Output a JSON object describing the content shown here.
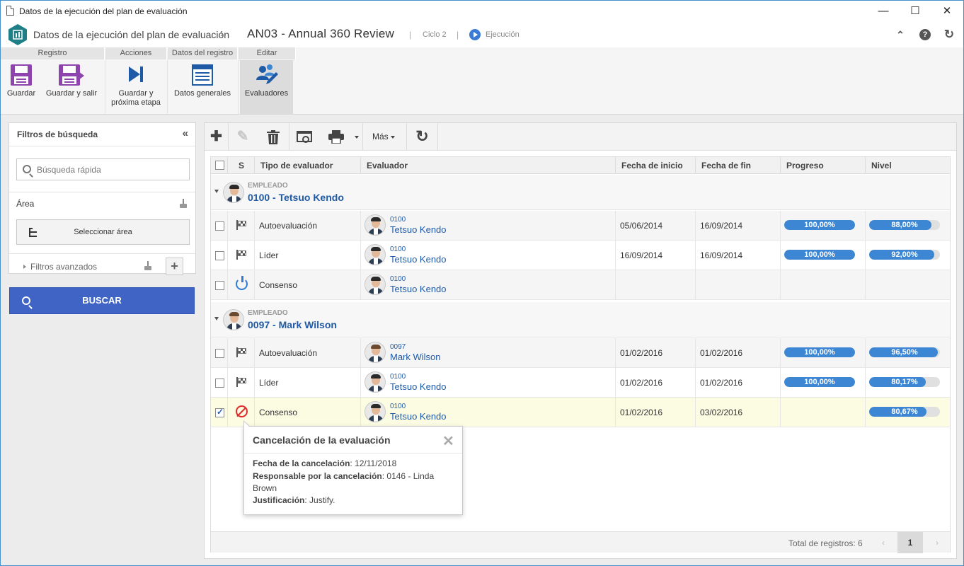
{
  "window": {
    "title": "Datos de la ejecución del plan de evaluación",
    "minimize": "—",
    "maximize": "☐",
    "close": "✕"
  },
  "header": {
    "breadcrumb": "Datos de la ejecución del plan de evaluación",
    "chevron": "›",
    "record": "AN03 - Annual 360 Review",
    "separator": "|",
    "cycle": "Ciclo 2",
    "status": "Ejecución",
    "icons": [
      "collapse-up-icon",
      "help-icon",
      "refresh-icon"
    ],
    "collapse_glyph": "⌃",
    "help_glyph": "?",
    "refresh_glyph": "↻"
  },
  "ribbon": {
    "groups": [
      "Registro",
      "Acciones",
      "Datos del registro",
      "Editar"
    ],
    "buttons": {
      "save": "Guardar",
      "save_exit": "Guardar y salir",
      "save_next_1": "Guardar y",
      "save_next_2": "próxima etapa",
      "general": "Datos generales",
      "evaluators": "Evaluadores"
    },
    "accent": "#8e44ad",
    "blue": "#1f5aa6"
  },
  "filters": {
    "title": "Filtros de búsqueda",
    "collapse": "«",
    "quick_search_placeholder": "Búsqueda rápida",
    "area_label": "Área",
    "select_area": "Seleccionar área",
    "advanced": "Filtros avanzados",
    "add": "+",
    "search_button": "BUSCAR"
  },
  "toolbar": {
    "add": "✚",
    "edit": "✎",
    "delete": "🗑",
    "view": "◉",
    "print": "⎙",
    "more": "Más",
    "refresh": "↻"
  },
  "grid": {
    "columns": [
      "S",
      "Tipo de evaluador",
      "Evaluador",
      "Fecha de inicio",
      "Fecha de fin",
      "Progreso",
      "Nivel"
    ],
    "groups": [
      {
        "label": "EMPLEADO",
        "name": "0100 - Tetsuo Kendo",
        "rows": [
          {
            "status": "flag",
            "type": "Autoevaluación",
            "code": "0100",
            "evaluator": "Tetsuo Kendo",
            "start": "05/06/2014",
            "end": "16/09/2014",
            "progress": "100,00%",
            "progress_value": 100,
            "level": "88,00%",
            "level_value": 88,
            "checked": false
          },
          {
            "status": "flag",
            "type": "Líder",
            "code": "0100",
            "evaluator": "Tetsuo Kendo",
            "start": "16/09/2014",
            "end": "16/09/2014",
            "progress": "100,00%",
            "progress_value": 100,
            "level": "92,00%",
            "level_value": 92,
            "checked": false
          },
          {
            "status": "power",
            "type": "Consenso",
            "code": "0100",
            "evaluator": "Tetsuo Kendo",
            "start": "",
            "end": "",
            "progress": "",
            "level": "",
            "checked": false
          }
        ]
      },
      {
        "label": "EMPLEADO",
        "name": "0097 - Mark Wilson",
        "rows": [
          {
            "status": "flag",
            "type": "Autoevaluación",
            "code": "0097",
            "evaluator": "Mark Wilson",
            "start": "01/02/2016",
            "end": "01/02/2016",
            "progress": "100,00%",
            "progress_value": 100,
            "level": "96,50%",
            "level_value": 96.5,
            "checked": false
          },
          {
            "status": "flag",
            "type": "Líder",
            "code": "0100",
            "evaluator": "Tetsuo Kendo",
            "start": "01/02/2016",
            "end": "01/02/2016",
            "progress": "100,00%",
            "progress_value": 100,
            "level": "80,17%",
            "level_value": 80.17,
            "checked": false
          },
          {
            "status": "cancel",
            "type": "Consenso",
            "code": "0100",
            "evaluator": "Tetsuo Kendo",
            "start": "01/02/2016",
            "end": "03/02/2016",
            "progress": "",
            "level": "80,67%",
            "level_value": 80.67,
            "checked": true
          }
        ]
      }
    ],
    "footer": {
      "total": "Total de registros: 6",
      "prev": "‹",
      "page": "1",
      "next": "›"
    }
  },
  "popup": {
    "title": "Cancelación de la evaluación",
    "close": "✕",
    "date_label": "Fecha de la cancelación",
    "date_value": ": 12/11/2018",
    "resp_label": "Responsable por la cancelación",
    "resp_value": ": 0146 - Linda Brown",
    "just_label": "Justificación",
    "just_value": ": Justify."
  }
}
